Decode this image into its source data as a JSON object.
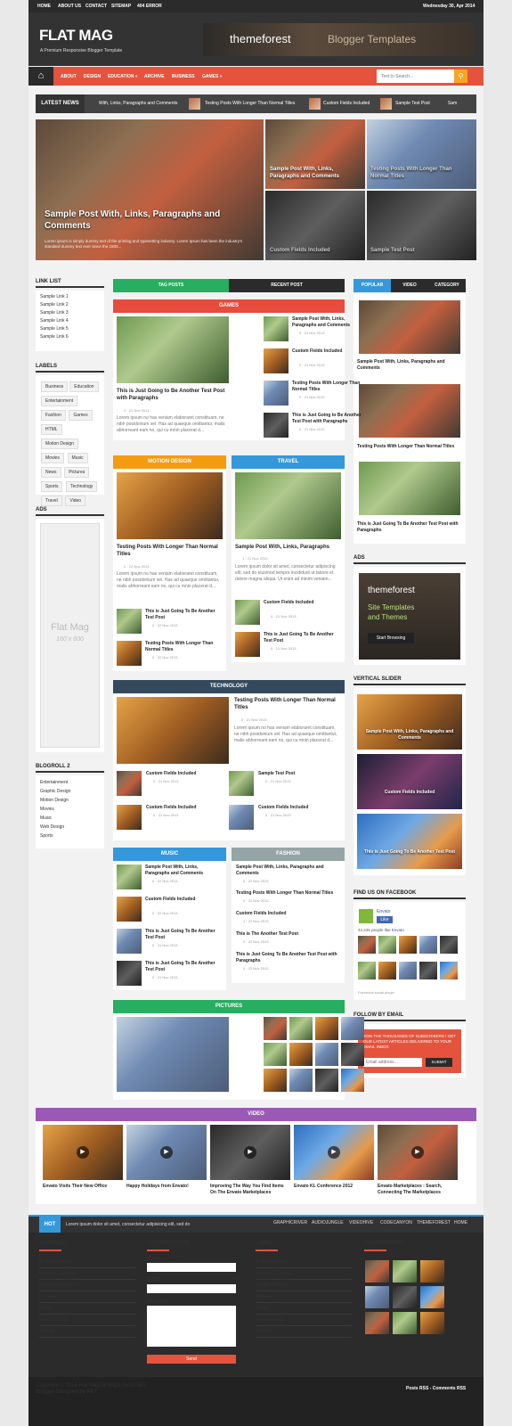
{
  "topbar": {
    "links": [
      "HOME",
      "ABOUT US",
      "CONTACT",
      "SITEMAP",
      "404 ERROR"
    ],
    "date": "Wednesday 30, Apr 2014"
  },
  "header": {
    "logo": "FLAT MAG",
    "tagline": "A Premium Responsive Blogger Template",
    "banner_left": "themeforest",
    "banner_right": "Blogger Templates"
  },
  "nav": {
    "items": [
      "ABOUT",
      "DESIGN",
      "EDUCATION »",
      "ARCHIVE",
      "BUSINESS",
      "GAMES »"
    ],
    "search_placeholder": "Text to Search...",
    "home_icon": "home-icon",
    "search_icon": "search-icon"
  },
  "ticker": {
    "label": "LATEST NEWS",
    "items": [
      "With, Links, Paragraphs and Comments",
      "Testing Posts With Longer Than Normal Titles",
      "Custom Fields Included",
      "Sample Test Post",
      "Sam"
    ]
  },
  "slider": {
    "main_title": "Sample Post With, Links, Paragraphs and Comments",
    "main_excerpt": "Lorem ipsum is simply dummy text of the printing and typesetting industry. Lorem Ipsum has been the industry's standard dummy text ever since the 1500...",
    "tiles": [
      "Sample Post With, Links, Paragraphs and Comments",
      "Testing Posts With Longer Than Normal Titles",
      "Custom Fields Included",
      "Sample Test Post"
    ]
  },
  "left": {
    "linklist_title": "LINK LIST",
    "links": [
      "Sample Link 1",
      "Sample Link 2",
      "Sample Link 3",
      "Sample Link 4",
      "Sample Link 5",
      "Sample Link 6"
    ],
    "labels_title": "LABELS",
    "labels": [
      "Business",
      "Education",
      "Entertainment",
      "Fashion",
      "Games",
      "HTML",
      "Motion Design",
      "Movies",
      "Music",
      "News",
      "Pictures",
      "Sports",
      "Technology",
      "Travel",
      "Video"
    ],
    "ads_title": "ADS",
    "ad_name": "Flat Mag",
    "ad_size": "160 x 600",
    "blogroll_title": "BLOGROLL 2",
    "blogroll": [
      "Entertainment",
      "Graphic Design",
      "Motion Design",
      "Movies",
      "Music",
      "Web Design",
      "Sports"
    ]
  },
  "tabs": {
    "tag": "TAG POSTS",
    "recent": "RECENT POST"
  },
  "games": {
    "title": "GAMES",
    "main_title": "This is Just Going to Be Another Test Post with Paragraphs",
    "main_meta": "4 · 21 Nov 2013",
    "main_excerpt": "Lorem ipsum no has veniam elaboraret constituam, ne nibh posidonium vel. Has ad quaeque omittantur, malis abhorreant eam no, qui cu mnin placerat d...",
    "list": [
      {
        "t": "Sample Post With, Links, Paragraphs and Comments",
        "m": "4 · 21 Nov 2013"
      },
      {
        "t": "Custom Fields Included",
        "m": "0 · 21 Nov 2013"
      },
      {
        "t": "Testing Posts With Longer Than Normal Titles",
        "m": "0 · 21 Nov 2013"
      },
      {
        "t": "This is Just Going to Be Another Test Post with Paragraphs",
        "m": "0 · 21 Nov 2013"
      }
    ]
  },
  "motion": {
    "title": "MOTION DESIGN",
    "main_title": "Testing Posts With Longer Than Normal Titles",
    "main_meta": "2 · 22 Nov 2013",
    "main_excerpt": "Lorem ipsum no has veniam elaboraret constituam, ne nibh posidonium vel. Has ad quaeque omittantur, malis abhorreant eam no, qui cu mnin placerat d...",
    "list": [
      {
        "t": "This is Just Going To Be Another Test Post",
        "m": "0 · 22 Nov 2013"
      },
      {
        "t": "Testing Posts With Longer Than Normal Titles",
        "m": "0 · 22 Nov 2013"
      }
    ]
  },
  "travel": {
    "title": "TRAVEL",
    "main_title": "Sample Post With, Links, Paragraphs",
    "main_meta": "1 · 21 Nov 2013",
    "main_excerpt": "Lorem ipsum dolor sit amet, consectetur adipiscing elit, sed do eiusmod tempor incididunt ut labore et dolore magna aliqua. Ut enim ad minim veniam...",
    "list": [
      {
        "t": "Custom Fields Included",
        "m": "0 · 21 Nov 2013"
      },
      {
        "t": "This is Just Going To Be Another Test Post",
        "m": "0 · 21 Nov 2013"
      }
    ]
  },
  "technology": {
    "title": "TECHNOLOGY",
    "main_title": "Testing Posts With Longer Than Normal Titles",
    "main_meta": "0 · 21 Nov 2013",
    "main_excerpt": "Lorem ipsum no has veniam elaboraret constituam, ne nibh posidonium vel. Has ad quaeque omittantur, malis abhorreant eam no, qui cu mnin placerat d...",
    "grid": [
      {
        "t": "Custom Fields Included",
        "m": "0 · 21 Nov 2013"
      },
      {
        "t": "Sample Test Post",
        "m": "0 · 21 Nov 2013"
      },
      {
        "t": "Custom Fields Included",
        "m": "0 · 21 Nov 2013"
      },
      {
        "t": "Custom Fields Included",
        "m": "0 · 21 Nov 2013"
      }
    ]
  },
  "music": {
    "title": "MUSIC",
    "list": [
      {
        "t": "Sample Post With, Links, Paragraphs and Comments",
        "m": "0 · 22 Nov 2013"
      },
      {
        "t": "Custom Fields Included",
        "m": "0 · 22 Nov 2013"
      },
      {
        "t": "This is Just Going To Be Another Test Post",
        "m": "0 · 21 Nov 2013"
      },
      {
        "t": "This is Just Going To Be Another Test Post",
        "m": "0 · 21 Nov 2013"
      }
    ]
  },
  "fashion": {
    "title": "FASHION",
    "list": [
      {
        "t": "Sample Post With, Links, Paragraphs and Comments",
        "m": "0 · 22 Nov 2013"
      },
      {
        "t": "Testing Posts With Longer Than Normal Titles",
        "m": "2 · 22 Nov 2013"
      },
      {
        "t": "Custom Fields Included",
        "m": "1 · 22 Nov 2013"
      },
      {
        "t": "This is The Another Test Post",
        "m": "0 · 22 Nov 2013"
      },
      {
        "t": "This is Just Going To Be Another Test Post with Paragraphs",
        "m": "0 · 22 Nov 2013"
      }
    ]
  },
  "pictures": {
    "title": "PICTURES"
  },
  "right": {
    "tabs": [
      "POPULAR",
      "VIDEO",
      "CATEGORY"
    ],
    "popular": [
      "Sample Post With, Links, Paragraphs and Comments",
      "Testing Posts With Longer Than Normal Titles",
      "This is Just Going To Be Another Test Post with Paragraphs"
    ],
    "ads_title": "ADS",
    "ad_brand": "themeforest",
    "ad_line1": "Site Templates",
    "ad_line2": "and Themes",
    "ad_btn": "Start Browsing",
    "vslider_title": "VERTICAL SLIDER",
    "vslides": [
      "Sample Post With, Links, Paragraphs and Comments",
      "Custom Fields Included",
      "This is Just Going To Be Another Test Post"
    ],
    "fb_title": "FIND US ON FACEBOOK",
    "fb_name": "Envato",
    "fb_like": "Like",
    "fb_count": "42,245 people like",
    "fb_count_name": "Envato",
    "fb_plugin": "Facebook social plugin",
    "email_title": "FOLLOW BY EMAIL",
    "email_text": "JOIN THE THOUSANDS OF SUBSCRIBERS ! GET OUR LATEST ARTICLES DELIVERED TO YOUR EMAIL INBOX",
    "email_placeholder": "Email address...",
    "email_btn": "SUBMIT"
  },
  "video": {
    "title": "VIDEO",
    "items": [
      "Envato Visits Their New Office",
      "Happy Holidays from Envato!",
      "Improving The Way You Find Items On The Envato Marketplaces",
      "Envato KL Conference 2012",
      "Envato Marketplaces : Search, Connecting The Marketplaces"
    ]
  },
  "hot": {
    "label": "HOT",
    "text": "Lorem ipsum dolor sit amet, consectetur adipisicing elit, sed do",
    "links": [
      "GRAPHICRIVER",
      "AUDIOJUNGLE",
      "VIDEOHIVE",
      "CODECANYON",
      "THEMEFOREST",
      "HOME"
    ]
  },
  "footer": {
    "blogroll_title": "BLOGROLL",
    "blogroll": [
      "Entertainment",
      "Graphic Design",
      "Motion Design",
      "Movies",
      "Music",
      "Web Design",
      "Sports"
    ],
    "contact_title": "CONTACT FORM",
    "name_label": "Name",
    "email_label": "Email",
    "message_label": "Message",
    "send": "Send",
    "label_title": "LABEL",
    "labels": [
      "Entertainment",
      "Graphic Design",
      "Motion Design",
      "Movies",
      "Music",
      "Web Design",
      "Sports"
    ],
    "flickr_title": "FLICKR IMAGES",
    "copyright": "Copyright © 2014 Flat Mag All Right Reserved",
    "designed": "Blogger Designed by PBT",
    "rss": "Posts RSS - Comments RSS"
  }
}
